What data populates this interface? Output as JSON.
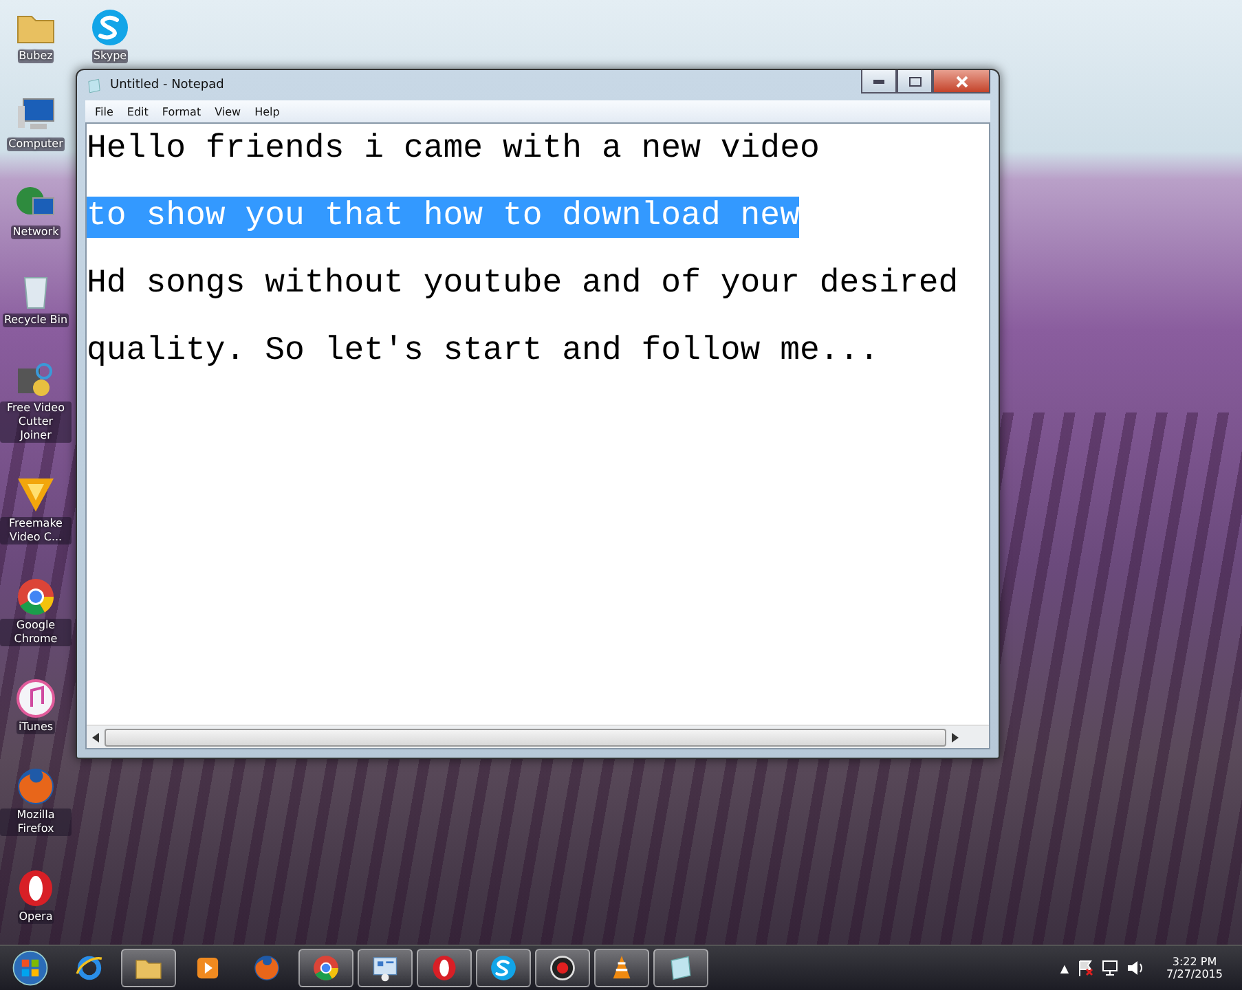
{
  "desktop_icons": [
    {
      "label": "Bubez",
      "kind": "folder"
    },
    {
      "label": "Skype",
      "kind": "skype"
    },
    {
      "label": "Computer",
      "kind": "computer"
    },
    {
      "label": "Network",
      "kind": "network"
    },
    {
      "label": "Recycle Bin",
      "kind": "recycle"
    },
    {
      "label": "Free Video Cutter Joiner",
      "kind": "cutter"
    },
    {
      "label": "Freemake Video C...",
      "kind": "freemake"
    },
    {
      "label": "Google Chrome",
      "kind": "chrome"
    },
    {
      "label": "iTunes",
      "kind": "itunes"
    },
    {
      "label": "Mozilla Firefox",
      "kind": "firefox"
    },
    {
      "label": "Opera",
      "kind": "opera"
    }
  ],
  "window": {
    "title": "Untitled - Notepad",
    "menu": [
      "File",
      "Edit",
      "Format",
      "View",
      "Help"
    ],
    "lines": [
      {
        "text": "Hello friends i came with a new video",
        "selected": false
      },
      {
        "text": "to show you that how to download new",
        "selected": true
      },
      {
        "text": "Hd songs without youtube and of your desired",
        "selected": false
      },
      {
        "text": "quality. So let's start and follow me...",
        "selected": false
      }
    ]
  },
  "taskbar": {
    "items": [
      {
        "kind": "ie",
        "running": false
      },
      {
        "kind": "folder",
        "running": true
      },
      {
        "kind": "media",
        "running": false
      },
      {
        "kind": "firefox",
        "running": false
      },
      {
        "kind": "chrome",
        "running": true
      },
      {
        "kind": "panel",
        "running": true
      },
      {
        "kind": "opera",
        "running": true
      },
      {
        "kind": "skype",
        "running": true
      },
      {
        "kind": "record",
        "running": true
      },
      {
        "kind": "vlc",
        "running": true
      },
      {
        "kind": "notepad",
        "running": true
      }
    ],
    "tray_arrow": "▲",
    "time": "3:22 PM",
    "date": "7/27/2015"
  }
}
